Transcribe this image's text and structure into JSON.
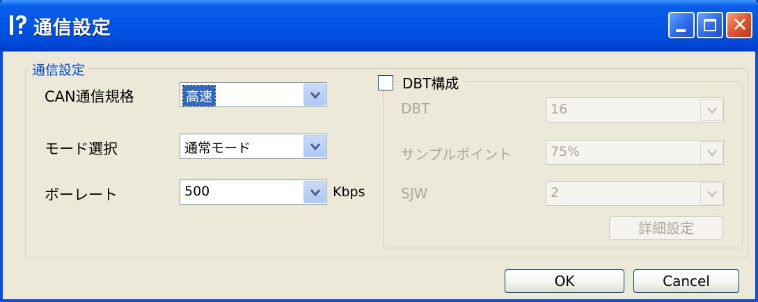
{
  "window": {
    "title": "通信設定",
    "close_glyph": "✕"
  },
  "group": {
    "legend": "通信設定"
  },
  "fields": {
    "can_label": "CAN通信規格",
    "can_value": "高速",
    "mode_label": "モード選択",
    "mode_value": "通常モード",
    "baud_label": "ボーレート",
    "baud_value": "500",
    "baud_unit": "Kbps"
  },
  "dbt": {
    "checkbox_label": "DBT構成",
    "checked": false,
    "dbt_label": "DBT",
    "dbt_value": "16",
    "sample_label": "サンプルポイント",
    "sample_value": "75%",
    "sjw_label": "SJW",
    "sjw_value": "2",
    "detail_button": "詳細設定"
  },
  "buttons": {
    "ok": "OK",
    "cancel": "Cancel"
  },
  "colors": {
    "titlebar": "#0055e5",
    "accent": "#0046d5",
    "selection": "#316ac5",
    "disabled_text": "#aca899"
  },
  "icons": {
    "app": "help-pointer-icon",
    "dropdown": "chevron-down-icon"
  }
}
